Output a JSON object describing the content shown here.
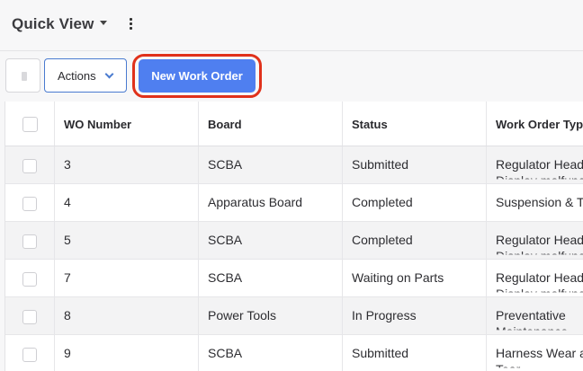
{
  "header": {
    "title": "Quick View"
  },
  "toolbar": {
    "actions_label": "Actions",
    "new_work_order_label": "New Work Order"
  },
  "table": {
    "columns": [
      "WO Number",
      "Board",
      "Status",
      "Work Order Typ"
    ],
    "rows": [
      {
        "wo": "3",
        "board": "SCBA",
        "status": "Submitted",
        "type": "Regulator Head",
        "type2": "Display malfunc"
      },
      {
        "wo": "4",
        "board": "Apparatus Board",
        "status": "Completed",
        "type": "Suspension & T",
        "type2": ""
      },
      {
        "wo": "5",
        "board": "SCBA",
        "status": "Completed",
        "type": "Regulator Head",
        "type2": "Display malfunc"
      },
      {
        "wo": "7",
        "board": "SCBA",
        "status": "Waiting on Parts",
        "type": "Regulator Head",
        "type2": "Display malfunc"
      },
      {
        "wo": "8",
        "board": "Power Tools",
        "status": "In Progress",
        "type": "Preventative",
        "type2": "Maintenance"
      },
      {
        "wo": "9",
        "board": "SCBA",
        "status": "Submitted",
        "type": "Harness Wear a",
        "type2": "Tear"
      }
    ]
  },
  "colors": {
    "primary": "#4f7ff0",
    "highlight": "#e0311b",
    "accent_border": "#4a7bd0"
  }
}
